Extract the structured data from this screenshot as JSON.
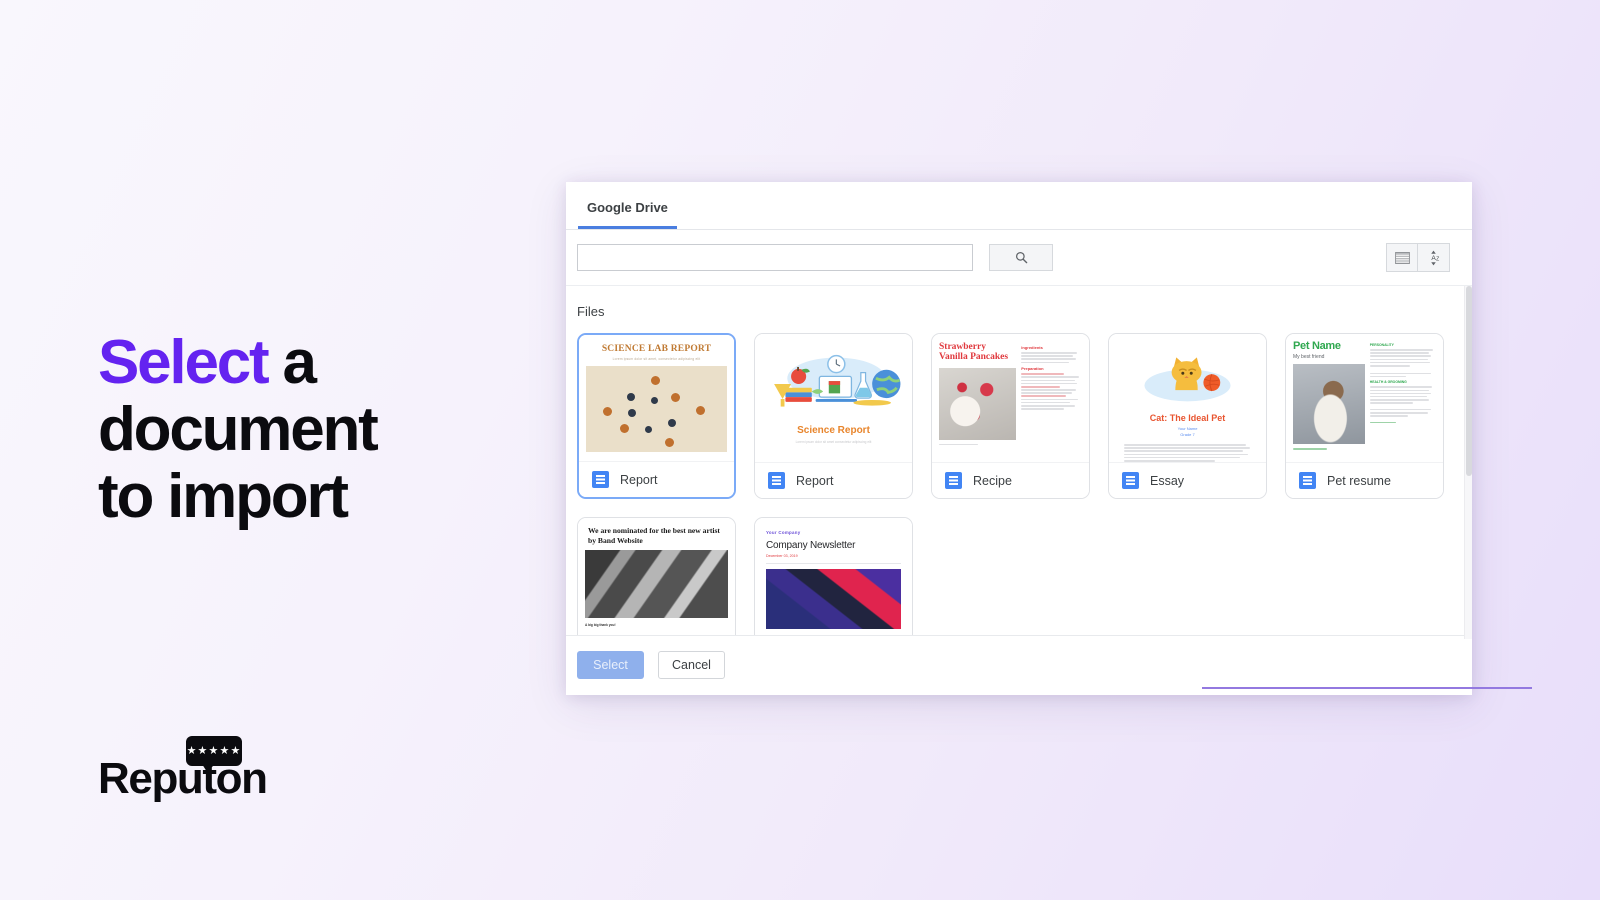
{
  "brand": {
    "logo_word": "Reputon",
    "logo_stars": "★★★★★",
    "accent_color": "#6423f0"
  },
  "headline": {
    "accent_word": "Select",
    "line1_rest": " a",
    "line2": "document",
    "line3": "to import"
  },
  "dialog": {
    "tabs": [
      {
        "label": "Google Drive",
        "active": true
      }
    ],
    "search": {
      "value": "",
      "placeholder": ""
    },
    "search_button_icon": "search-icon",
    "view_toggle_icon": "list-view-icon",
    "sort_icon": "sort-alpha-icon",
    "section_title": "Files",
    "footer": {
      "select_label": "Select",
      "cancel_label": "Cancel"
    }
  },
  "files": [
    {
      "name": "Report",
      "selected": true,
      "icon": "google-docs-icon",
      "thumb": {
        "kind": "science-lab-report",
        "title": "SCIENCE LAB REPORT",
        "subtitle": "Lorem ipsum dolor sit amet, consectetur adipiscing elit"
      }
    },
    {
      "name": "Report",
      "selected": false,
      "icon": "google-docs-icon",
      "thumb": {
        "kind": "science-report",
        "title": "Science Report",
        "subtitle": "Lorem ipsum dolor sit amet consectetur adipiscing elit"
      }
    },
    {
      "name": "Recipe",
      "selected": false,
      "icon": "google-docs-icon",
      "thumb": {
        "kind": "recipe",
        "title": "Strawberry Vanilla Pancakes",
        "heading_ingredients": "Ingredients",
        "heading_preparation": "Preparation"
      }
    },
    {
      "name": "Essay",
      "selected": false,
      "icon": "google-docs-icon",
      "thumb": {
        "kind": "essay",
        "title": "Cat: The Ideal Pet",
        "byline": "Your Name",
        "grade": "Grade 7"
      }
    },
    {
      "name": "Pet resume",
      "selected": false,
      "icon": "google-docs-icon",
      "thumb": {
        "kind": "pet-resume",
        "title": "Pet Name",
        "subtitle": "My best friend",
        "heading_personality": "PERSONALITY",
        "heading_health": "HEALTH & GROOMING"
      }
    },
    {
      "name": "",
      "selected": false,
      "icon": "google-docs-icon",
      "thumb": {
        "kind": "band-news",
        "title": "We are nominated for the best new artist by Band Website",
        "footer": "A big big thank you!"
      }
    },
    {
      "name": "",
      "selected": false,
      "icon": "google-docs-icon",
      "thumb": {
        "kind": "newsletter",
        "company": "Your Company",
        "title": "Company Newsletter",
        "date": "December 03, 2019"
      }
    }
  ]
}
